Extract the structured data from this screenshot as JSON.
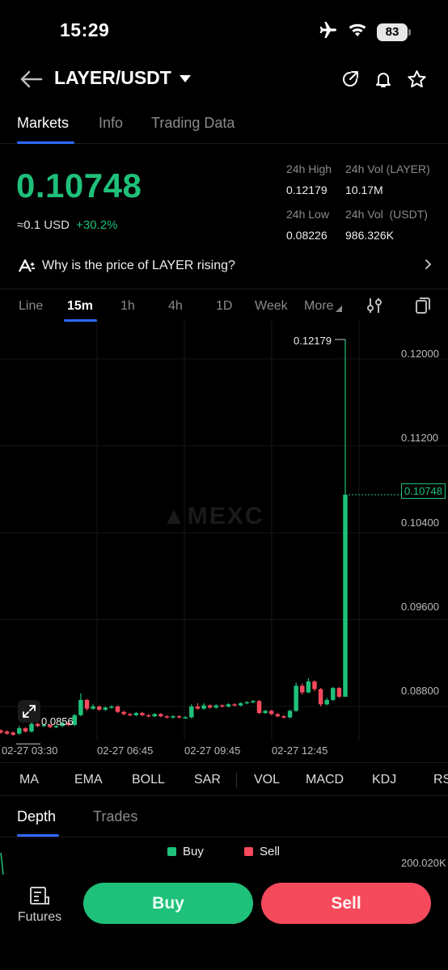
{
  "status_bar": {
    "time": "15:29",
    "battery": "83",
    "icons": [
      "airplane-icon",
      "wifi-icon",
      "battery-icon"
    ]
  },
  "header": {
    "pair": "LAYER/USDT",
    "icons": [
      "back-arrow-icon",
      "share-icon",
      "bell-icon",
      "star-icon"
    ]
  },
  "tabs": [
    {
      "label": "Markets",
      "active": true
    },
    {
      "label": "Info",
      "active": false
    },
    {
      "label": "Trading Data",
      "active": false
    }
  ],
  "price": {
    "last": "0.10748",
    "usd_approx": "≈0.1",
    "usd_unit": "USD",
    "change": "+30.2%",
    "up_color": "#1fc07a",
    "down_color": "#f54a5c"
  },
  "stats": {
    "high_label": "24h High",
    "high_value": "0.12179",
    "vol_base_label": "24h Vol (LAYER)",
    "vol_base_value": "10.17M",
    "low_label": "24h Low",
    "low_value": "0.08226",
    "vol_quote_label": "24h Vol  (USDT)",
    "vol_quote_value": "986.326K"
  },
  "reason": {
    "text": "Why is the price of LAYER rising?"
  },
  "intervals": [
    {
      "label": "Line",
      "active": false
    },
    {
      "label": "15m",
      "active": true
    },
    {
      "label": "1h",
      "active": false
    },
    {
      "label": "4h",
      "active": false
    },
    {
      "label": "1D",
      "active": false
    },
    {
      "label": "Week",
      "active": false
    },
    {
      "label": "More",
      "active": false
    }
  ],
  "chart": {
    "watermark": "MEXC",
    "high_marker": "0.12179",
    "low_marker": "0.0856",
    "current_marker": "0.10748"
  },
  "chart_data": {
    "type": "candlestick",
    "y_ticks": [
      "0.12000",
      "0.11200",
      "0.10400",
      "0.09600",
      "0.08800"
    ],
    "ylim": [
      0.0848,
      0.1235
    ],
    "x_ticks": [
      "02-27 03:30",
      "02-27 06:45",
      "02-27 09:45",
      "02-27 12:45"
    ],
    "candles": [
      {
        "o": 0.0858,
        "c": 0.0856,
        "h": 0.0859,
        "l": 0.0855
      },
      {
        "o": 0.0857,
        "c": 0.0855,
        "h": 0.0858,
        "l": 0.0854
      },
      {
        "o": 0.0856,
        "c": 0.0854,
        "h": 0.0857,
        "l": 0.0853
      },
      {
        "o": 0.0855,
        "c": 0.086,
        "h": 0.0862,
        "l": 0.0854
      },
      {
        "o": 0.086,
        "c": 0.0857,
        "h": 0.0861,
        "l": 0.0856
      },
      {
        "o": 0.0857,
        "c": 0.0864,
        "h": 0.0866,
        "l": 0.0856
      },
      {
        "o": 0.0864,
        "c": 0.0862,
        "h": 0.0865,
        "l": 0.0861
      },
      {
        "o": 0.0862,
        "c": 0.0863,
        "h": 0.0864,
        "l": 0.0861
      },
      {
        "o": 0.0863,
        "c": 0.0861,
        "h": 0.0864,
        "l": 0.086
      },
      {
        "o": 0.0861,
        "c": 0.0862,
        "h": 0.0863,
        "l": 0.086
      },
      {
        "o": 0.0862,
        "c": 0.0865,
        "h": 0.0866,
        "l": 0.0861
      },
      {
        "o": 0.0865,
        "c": 0.0863,
        "h": 0.0866,
        "l": 0.0862
      },
      {
        "o": 0.0863,
        "c": 0.0872,
        "h": 0.0873,
        "l": 0.0862
      },
      {
        "o": 0.0872,
        "c": 0.0886,
        "h": 0.0892,
        "l": 0.0871
      },
      {
        "o": 0.0886,
        "c": 0.0878,
        "h": 0.0887,
        "l": 0.0876
      },
      {
        "o": 0.0878,
        "c": 0.088,
        "h": 0.0882,
        "l": 0.0877
      },
      {
        "o": 0.088,
        "c": 0.0877,
        "h": 0.0881,
        "l": 0.0876
      },
      {
        "o": 0.0877,
        "c": 0.0879,
        "h": 0.088,
        "l": 0.0876
      },
      {
        "o": 0.0879,
        "c": 0.088,
        "h": 0.0881,
        "l": 0.0878
      },
      {
        "o": 0.088,
        "c": 0.0875,
        "h": 0.0881,
        "l": 0.0874
      },
      {
        "o": 0.0875,
        "c": 0.0873,
        "h": 0.0876,
        "l": 0.0872
      },
      {
        "o": 0.0873,
        "c": 0.0872,
        "h": 0.0874,
        "l": 0.0871
      },
      {
        "o": 0.0872,
        "c": 0.0874,
        "h": 0.0875,
        "l": 0.0871
      },
      {
        "o": 0.0874,
        "c": 0.0872,
        "h": 0.0875,
        "l": 0.0871
      },
      {
        "o": 0.0872,
        "c": 0.0871,
        "h": 0.0873,
        "l": 0.087
      },
      {
        "o": 0.0871,
        "c": 0.0873,
        "h": 0.0874,
        "l": 0.087
      },
      {
        "o": 0.0873,
        "c": 0.0871,
        "h": 0.0874,
        "l": 0.087
      },
      {
        "o": 0.0871,
        "c": 0.087,
        "h": 0.0872,
        "l": 0.0869
      },
      {
        "o": 0.087,
        "c": 0.0871,
        "h": 0.0872,
        "l": 0.0869
      },
      {
        "o": 0.0871,
        "c": 0.087,
        "h": 0.0872,
        "l": 0.0869
      },
      {
        "o": 0.087,
        "c": 0.087,
        "h": 0.0871,
        "l": 0.0869
      },
      {
        "o": 0.087,
        "c": 0.088,
        "h": 0.0882,
        "l": 0.0869
      },
      {
        "o": 0.088,
        "c": 0.0878,
        "h": 0.0883,
        "l": 0.0877
      },
      {
        "o": 0.0878,
        "c": 0.0881,
        "h": 0.0883,
        "l": 0.0877
      },
      {
        "o": 0.0881,
        "c": 0.0879,
        "h": 0.0882,
        "l": 0.0878
      },
      {
        "o": 0.0879,
        "c": 0.0881,
        "h": 0.0882,
        "l": 0.0878
      },
      {
        "o": 0.0881,
        "c": 0.088,
        "h": 0.0882,
        "l": 0.0879
      },
      {
        "o": 0.088,
        "c": 0.0882,
        "h": 0.0883,
        "l": 0.0879
      },
      {
        "o": 0.0882,
        "c": 0.0881,
        "h": 0.0883,
        "l": 0.088
      },
      {
        "o": 0.0881,
        "c": 0.0883,
        "h": 0.0884,
        "l": 0.088
      },
      {
        "o": 0.0883,
        "c": 0.0884,
        "h": 0.0885,
        "l": 0.0882
      },
      {
        "o": 0.0884,
        "c": 0.0885,
        "h": 0.0886,
        "l": 0.0883
      },
      {
        "o": 0.0885,
        "c": 0.0874,
        "h": 0.0886,
        "l": 0.0873
      },
      {
        "o": 0.0874,
        "c": 0.0876,
        "h": 0.0877,
        "l": 0.0873
      },
      {
        "o": 0.0876,
        "c": 0.0873,
        "h": 0.0877,
        "l": 0.0872
      },
      {
        "o": 0.0873,
        "c": 0.0871,
        "h": 0.0874,
        "l": 0.087
      },
      {
        "o": 0.0871,
        "c": 0.087,
        "h": 0.0872,
        "l": 0.0869
      },
      {
        "o": 0.087,
        "c": 0.0876,
        "h": 0.0877,
        "l": 0.0869
      },
      {
        "o": 0.0876,
        "c": 0.0899,
        "h": 0.0902,
        "l": 0.0875
      },
      {
        "o": 0.0899,
        "c": 0.0893,
        "h": 0.0901,
        "l": 0.0891
      },
      {
        "o": 0.0893,
        "c": 0.0903,
        "h": 0.0906,
        "l": 0.0892
      },
      {
        "o": 0.0903,
        "c": 0.0896,
        "h": 0.0904,
        "l": 0.0894
      },
      {
        "o": 0.0896,
        "c": 0.0882,
        "h": 0.0897,
        "l": 0.088
      },
      {
        "o": 0.0882,
        "c": 0.0886,
        "h": 0.0888,
        "l": 0.0881
      },
      {
        "o": 0.0886,
        "c": 0.0897,
        "h": 0.0898,
        "l": 0.0885
      },
      {
        "o": 0.0897,
        "c": 0.0889,
        "h": 0.0898,
        "l": 0.0888
      },
      {
        "o": 0.0889,
        "c": 0.1075,
        "h": 0.12179,
        "l": 0.0889
      }
    ]
  },
  "indicators": [
    "MA",
    "EMA",
    "BOLL",
    "SAR",
    "VOL",
    "MACD",
    "KDJ",
    "RSI"
  ],
  "depth_tabs": [
    {
      "label": "Depth",
      "active": true
    },
    {
      "label": "Trades",
      "active": false
    }
  ],
  "depth": {
    "buy_label": "Buy",
    "sell_label": "Sell",
    "y_label": "200.020K"
  },
  "bottom": {
    "futures_label": "Futures",
    "buy_label": "Buy",
    "sell_label": "Sell"
  }
}
